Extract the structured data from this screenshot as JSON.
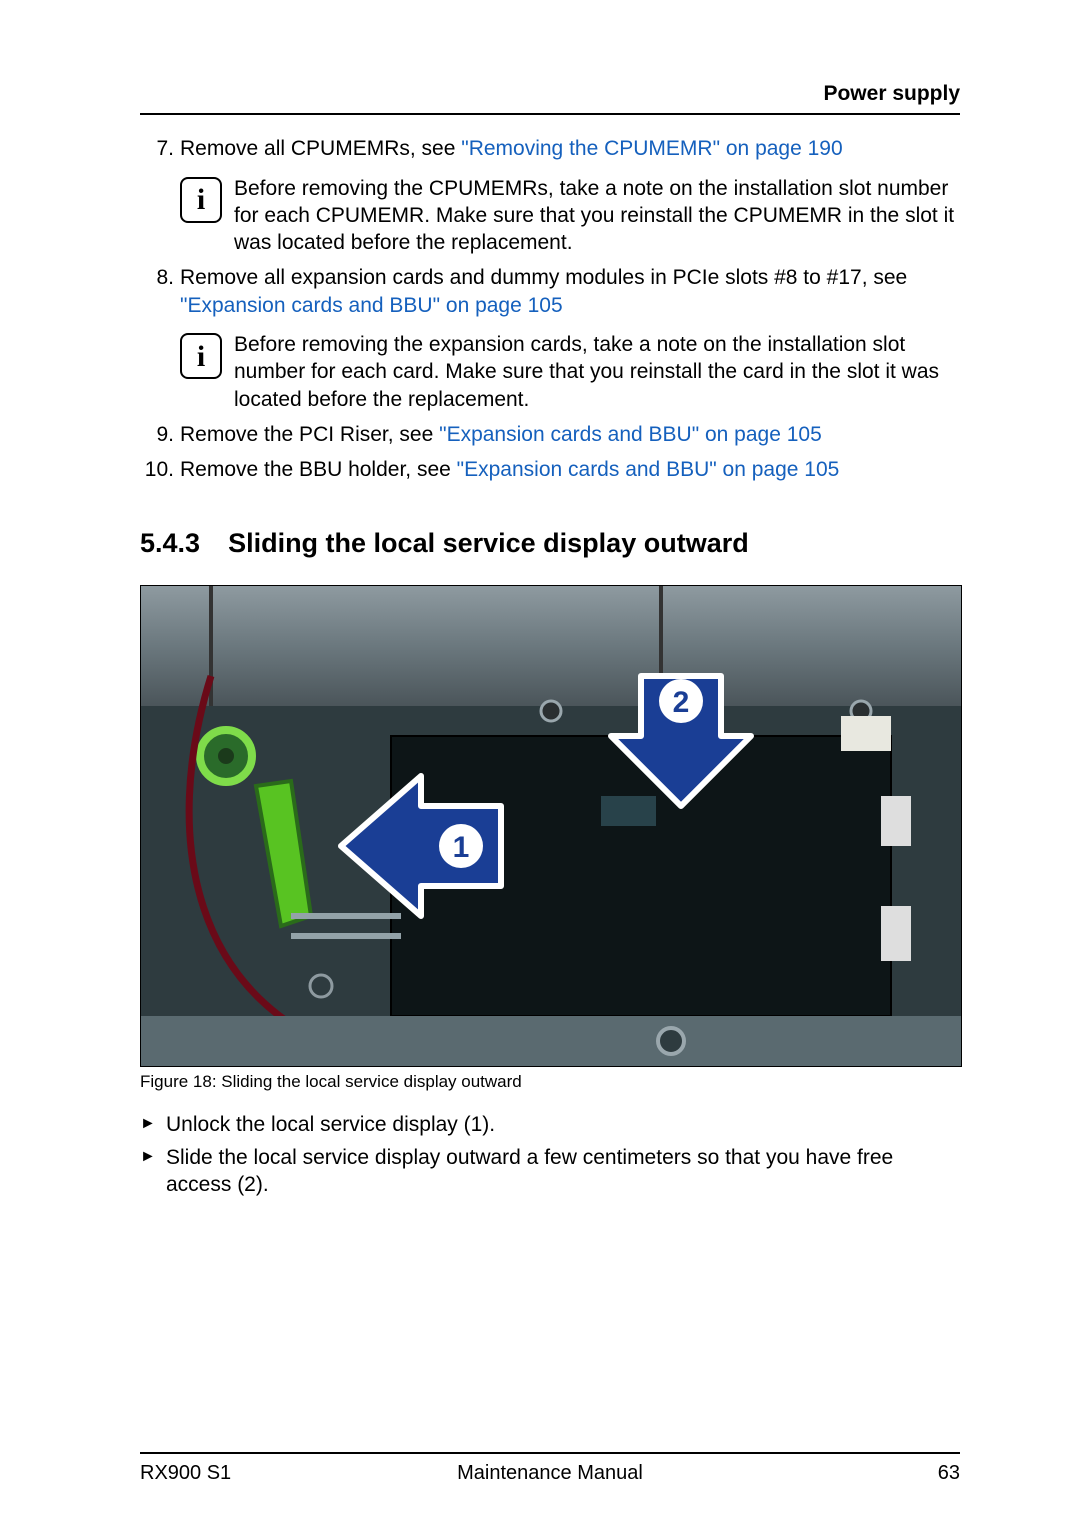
{
  "header": {
    "title": "Power supply"
  },
  "steps": [
    {
      "num": "7.",
      "text": "Remove all CPUMEMRs, see ",
      "link": "\"Removing the CPUMEMR\" on page 190",
      "info": "Before removing the CPUMEMRs, take a note on the installation slot number for each CPUMEMR. Make sure that you reinstall the CPUMEMR in the slot it was located before the replacement."
    },
    {
      "num": "8.",
      "text": "Remove all expansion cards and dummy modules in PCIe slots #8 to #17, see ",
      "link": "\"Expansion cards and BBU\" on page 105",
      "info": "Before removing the expansion cards, take a note on the installation slot number for each card. Make sure that you reinstall the card in the slot it was located before the replacement."
    },
    {
      "num": "9.",
      "text": "Remove the PCI Riser, see ",
      "link": "\"Expansion cards and BBU\" on page 105"
    },
    {
      "num": "10.",
      "text": "Remove the BBU holder, see ",
      "link": "\"Expansion cards and BBU\" on page 105"
    }
  ],
  "section": {
    "number": "5.4.3",
    "title": "Sliding the local service display outward"
  },
  "figure": {
    "caption": "Figure 18: Sliding the local service display outward",
    "callouts": {
      "left": "1",
      "down": "2"
    }
  },
  "actions": [
    "Unlock the local service display (1).",
    "Slide the local service display outward a few centimeters so that you have free access (2)."
  ],
  "footer": {
    "left": "RX900 S1",
    "center": "Maintenance Manual",
    "right": "63"
  }
}
